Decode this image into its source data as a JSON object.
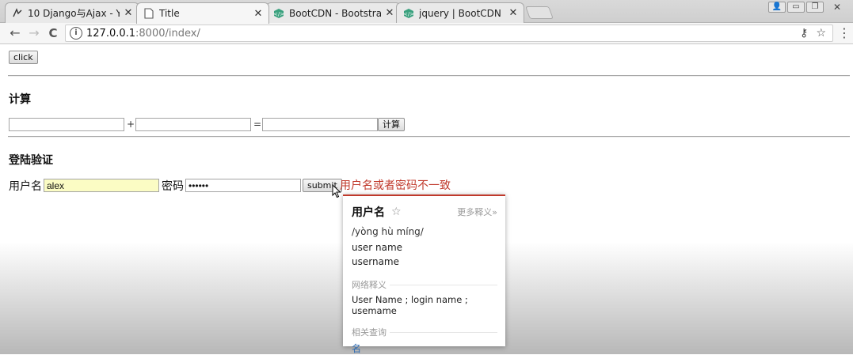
{
  "tabs": [
    {
      "label": "10 Django与Ajax - Yua",
      "icon": "youtube-like-icon",
      "active": false
    },
    {
      "label": "Title",
      "icon": "page-icon",
      "active": true
    },
    {
      "label": "BootCDN - Bootstrap 中",
      "icon": "bootcdn-icon",
      "active": false
    },
    {
      "label": "jquery | BootCDN - Boo",
      "icon": "bootcdn-icon",
      "active": false
    }
  ],
  "window_controls": {
    "profile": "👤",
    "minimize": "▭",
    "restore": "❐",
    "close": "✕"
  },
  "toolbar": {
    "back": "←",
    "forward": "→",
    "reload": "C",
    "url_host": "127.0.0.1",
    "url_path": ":8000/index/",
    "key_icon": "⚷",
    "star_icon": "☆",
    "menu_icon": "⋮"
  },
  "page": {
    "click_button": "click",
    "calc_heading": "计算",
    "plus": "+",
    "equals": "=",
    "calc_button": "计算",
    "login_heading": "登陆验证",
    "username_label": "用户名",
    "username_value": "alex",
    "password_label": "密码",
    "password_value": "••••••",
    "submit_button": "submit",
    "error_text": "用户名或者密码不一致"
  },
  "dictionary": {
    "word": "用户名",
    "star": "☆",
    "more": "更多释义»",
    "pinyin": "/yòng hù míng/",
    "meanings": [
      "user name",
      "username"
    ],
    "web_heading": "网络释义",
    "web_meaning": "User Name ; login name ; usemame",
    "related_heading": "相关查询",
    "related": "名"
  },
  "colors": {
    "error": "#c0392b",
    "autofill": "#fbfcc4",
    "link": "#2f6cb3"
  }
}
